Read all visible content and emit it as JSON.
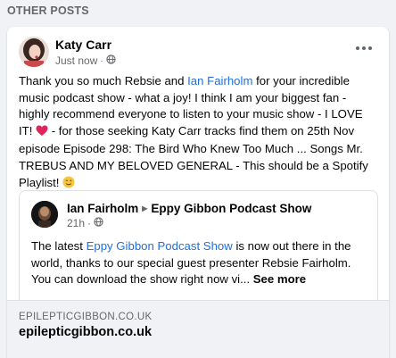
{
  "section": {
    "title": "OTHER POSTS"
  },
  "post": {
    "author": "Katy Carr",
    "time": "Just now",
    "privacy_icon": "globe-icon",
    "more_icon": "more-horizontal-icon",
    "text_before_link1": "Thank you so much Rebsie and ",
    "link1": "Ian Fairholm",
    "text_after_link1": "  for your incredible music podcast show - what a joy! I think I am your biggest fan - highly recommend everyone to listen to your music show - I LOVE IT! ",
    "heart_emoji": "❤️",
    "text_after_heart": " - for those seeking Katy Carr tracks find them on 25th Nov episode Episode 298: The Bird Who Knew Too Much ... Songs Mr. TREBUS AND MY BELOVED GENERAL - This should be a Spotify Playlist! ",
    "wink_emoji": "😉"
  },
  "shared": {
    "author": "Ian Fairholm",
    "separator_icon": "triangle-right-icon",
    "page": "Eppy Gibbon Podcast Show",
    "time": "21h",
    "privacy_icon": "globe-icon",
    "text_before_link": "The latest ",
    "link": "Eppy Gibbon Podcast Show",
    "text_after_link": " is now out there in the world, thanks to our special guest presenter Rebsie Fairholm. You can download the show right now vi... ",
    "see_more": "See more"
  },
  "link_preview": {
    "domain": "EPILEPTICGIBBON.CO.UK",
    "title": "epilepticgibbon.co.uk"
  }
}
